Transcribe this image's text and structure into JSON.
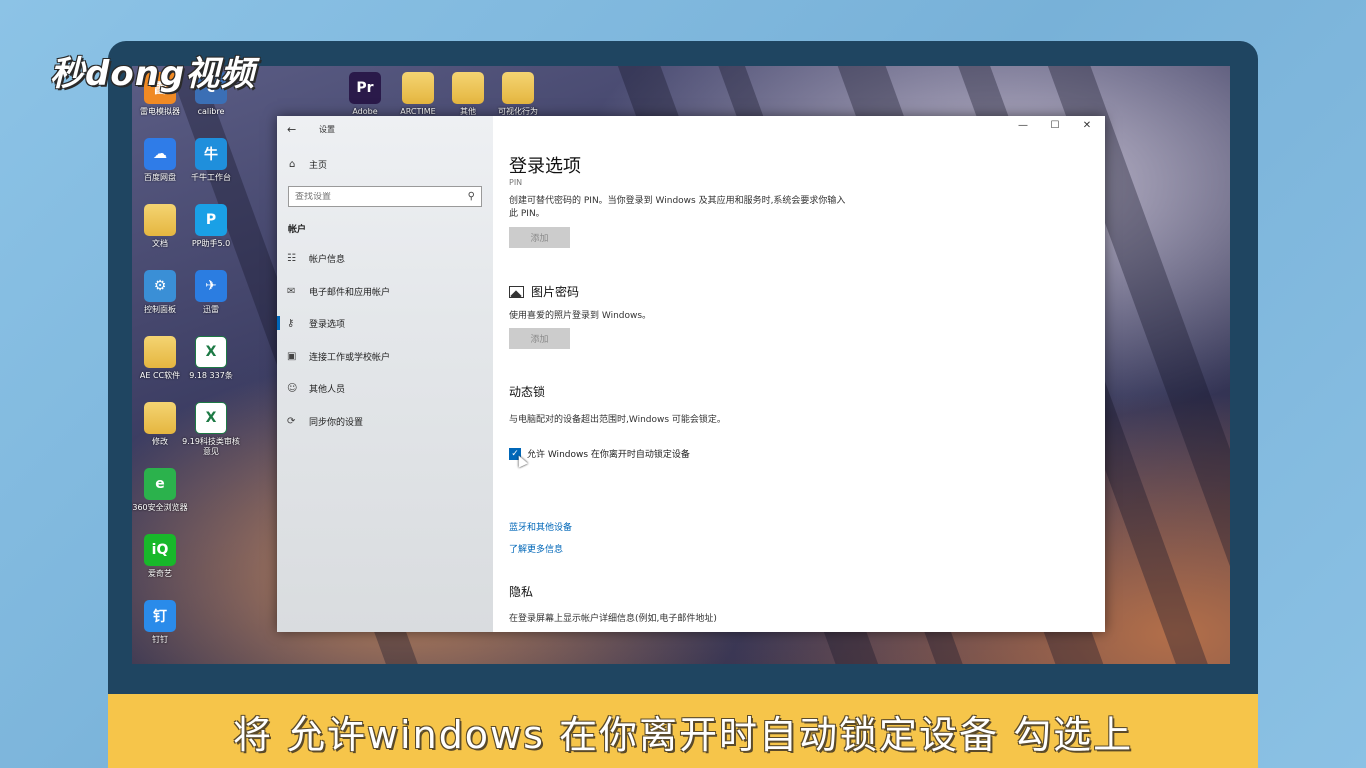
{
  "watermark": {
    "logo_text": "秒dong视频"
  },
  "desktop": {
    "icons": [
      {
        "label": "雷电模拟器",
        "glyph": "雷",
        "color": "#f08a24",
        "kind": "app"
      },
      {
        "label": "calibre",
        "glyph": "c",
        "color": "#3b6fb5",
        "kind": "app"
      },
      {
        "label": "Adobe",
        "glyph": "Pr",
        "color": "#2a1a4a",
        "kind": "app"
      },
      {
        "label": "ARCTIME",
        "glyph": "",
        "color": "#e5b640",
        "kind": "folder"
      },
      {
        "label": "其他",
        "glyph": "",
        "color": "#e5b640",
        "kind": "folder"
      },
      {
        "label": "可视化行为",
        "glyph": "",
        "color": "#e5b640",
        "kind": "folder"
      },
      {
        "label": "百度网盘",
        "glyph": "☁",
        "color": "#2f7ce8",
        "kind": "app"
      },
      {
        "label": "千牛工作台",
        "glyph": "牛",
        "color": "#1f8fdc",
        "kind": "app"
      },
      {
        "label": "文档",
        "glyph": "",
        "color": "#e5b640",
        "kind": "folder"
      },
      {
        "label": "PP助手5.0",
        "glyph": "P",
        "color": "#1aa0e6",
        "kind": "app"
      },
      {
        "label": "控制面板",
        "glyph": "⚙",
        "color": "#3a8fd6",
        "kind": "app"
      },
      {
        "label": "迅雷",
        "glyph": "✈",
        "color": "#2b7de1",
        "kind": "app"
      },
      {
        "label": "AE CC软件",
        "glyph": "",
        "color": "#e5b640",
        "kind": "folder"
      },
      {
        "label": "9.18 337条",
        "glyph": "X",
        "color": "#1d7a45",
        "kind": "excel"
      },
      {
        "label": "修改",
        "glyph": "",
        "color": "#e5b640",
        "kind": "folder"
      },
      {
        "label": "9.19科技类审核意见",
        "glyph": "X",
        "color": "#1d7a45",
        "kind": "excel"
      },
      {
        "label": "360安全浏览器",
        "glyph": "e",
        "color": "#2bb24c",
        "kind": "app"
      },
      {
        "label": "爱奇艺",
        "glyph": "iQ",
        "color": "#18b82a",
        "kind": "app"
      },
      {
        "label": "钉钉",
        "glyph": "钉",
        "color": "#2a8bea",
        "kind": "app"
      }
    ]
  },
  "window": {
    "app_title": "设置",
    "home_label": "主页",
    "search_placeholder": "查找设置",
    "section_label": "帐户",
    "nav_items": [
      {
        "label": "帐户信息",
        "icon": "person-card-icon"
      },
      {
        "label": "电子邮件和应用帐户",
        "icon": "mail-icon"
      },
      {
        "label": "登录选项",
        "icon": "key-icon",
        "active": true
      },
      {
        "label": "连接工作或学校帐户",
        "icon": "briefcase-icon"
      },
      {
        "label": "其他人员",
        "icon": "people-icon"
      },
      {
        "label": "同步你的设置",
        "icon": "sync-icon"
      }
    ],
    "controls": {
      "minimize": "—",
      "maximize": "☐",
      "close": "✕"
    },
    "content": {
      "page_title": "登录选项",
      "pin_fade_label": "PIN",
      "pin_desc": "创建可替代密码的 PIN。当你登录到 Windows 及其应用和服务时,系统会要求你输入此 PIN。",
      "pin_add_button": "添加",
      "picture_password_heading": "图片密码",
      "picture_password_desc": "使用喜爱的照片登录到 Windows。",
      "picture_add_button": "添加",
      "dynamic_lock_heading": "动态锁",
      "dynamic_lock_desc": "与电脑配对的设备超出范围时,Windows 可能会锁定。",
      "dynamic_lock_checkbox_label": "允许 Windows 在你离开时自动锁定设备",
      "dynamic_lock_checked": true,
      "link_bluetooth": "蓝牙和其他设备",
      "link_learn_more": "了解更多信息",
      "privacy_heading": "隐私",
      "privacy_desc": "在登录屏幕上显示帐户详细信息(例如,电子邮件地址)"
    }
  },
  "subtitle": {
    "text": "将 允许windows 在你离开时自动锁定设备 勾选上"
  },
  "colors": {
    "accent": "#0067b8",
    "subtitle_bg": "#f6c54a",
    "frame": "#1f4561"
  }
}
